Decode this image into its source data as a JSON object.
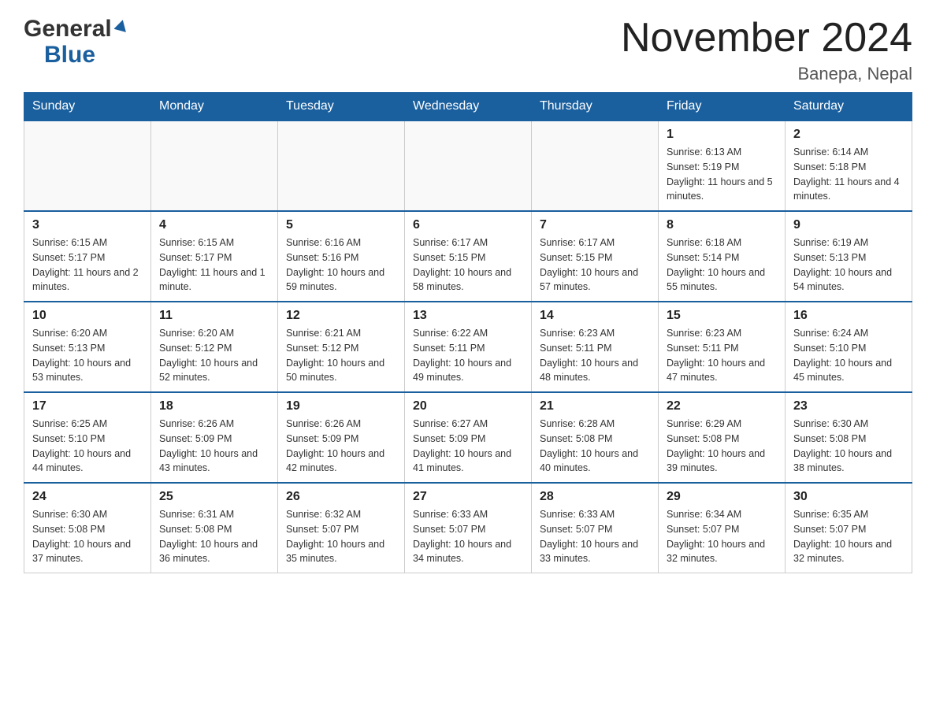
{
  "header": {
    "logo_general": "General",
    "logo_blue": "Blue",
    "title": "November 2024",
    "subtitle": "Banepa, Nepal"
  },
  "days_of_week": [
    "Sunday",
    "Monday",
    "Tuesday",
    "Wednesday",
    "Thursday",
    "Friday",
    "Saturday"
  ],
  "weeks": [
    [
      {
        "day": "",
        "info": ""
      },
      {
        "day": "",
        "info": ""
      },
      {
        "day": "",
        "info": ""
      },
      {
        "day": "",
        "info": ""
      },
      {
        "day": "",
        "info": ""
      },
      {
        "day": "1",
        "info": "Sunrise: 6:13 AM\nSunset: 5:19 PM\nDaylight: 11 hours and 5 minutes."
      },
      {
        "day": "2",
        "info": "Sunrise: 6:14 AM\nSunset: 5:18 PM\nDaylight: 11 hours and 4 minutes."
      }
    ],
    [
      {
        "day": "3",
        "info": "Sunrise: 6:15 AM\nSunset: 5:17 PM\nDaylight: 11 hours and 2 minutes."
      },
      {
        "day": "4",
        "info": "Sunrise: 6:15 AM\nSunset: 5:17 PM\nDaylight: 11 hours and 1 minute."
      },
      {
        "day": "5",
        "info": "Sunrise: 6:16 AM\nSunset: 5:16 PM\nDaylight: 10 hours and 59 minutes."
      },
      {
        "day": "6",
        "info": "Sunrise: 6:17 AM\nSunset: 5:15 PM\nDaylight: 10 hours and 58 minutes."
      },
      {
        "day": "7",
        "info": "Sunrise: 6:17 AM\nSunset: 5:15 PM\nDaylight: 10 hours and 57 minutes."
      },
      {
        "day": "8",
        "info": "Sunrise: 6:18 AM\nSunset: 5:14 PM\nDaylight: 10 hours and 55 minutes."
      },
      {
        "day": "9",
        "info": "Sunrise: 6:19 AM\nSunset: 5:13 PM\nDaylight: 10 hours and 54 minutes."
      }
    ],
    [
      {
        "day": "10",
        "info": "Sunrise: 6:20 AM\nSunset: 5:13 PM\nDaylight: 10 hours and 53 minutes."
      },
      {
        "day": "11",
        "info": "Sunrise: 6:20 AM\nSunset: 5:12 PM\nDaylight: 10 hours and 52 minutes."
      },
      {
        "day": "12",
        "info": "Sunrise: 6:21 AM\nSunset: 5:12 PM\nDaylight: 10 hours and 50 minutes."
      },
      {
        "day": "13",
        "info": "Sunrise: 6:22 AM\nSunset: 5:11 PM\nDaylight: 10 hours and 49 minutes."
      },
      {
        "day": "14",
        "info": "Sunrise: 6:23 AM\nSunset: 5:11 PM\nDaylight: 10 hours and 48 minutes."
      },
      {
        "day": "15",
        "info": "Sunrise: 6:23 AM\nSunset: 5:11 PM\nDaylight: 10 hours and 47 minutes."
      },
      {
        "day": "16",
        "info": "Sunrise: 6:24 AM\nSunset: 5:10 PM\nDaylight: 10 hours and 45 minutes."
      }
    ],
    [
      {
        "day": "17",
        "info": "Sunrise: 6:25 AM\nSunset: 5:10 PM\nDaylight: 10 hours and 44 minutes."
      },
      {
        "day": "18",
        "info": "Sunrise: 6:26 AM\nSunset: 5:09 PM\nDaylight: 10 hours and 43 minutes."
      },
      {
        "day": "19",
        "info": "Sunrise: 6:26 AM\nSunset: 5:09 PM\nDaylight: 10 hours and 42 minutes."
      },
      {
        "day": "20",
        "info": "Sunrise: 6:27 AM\nSunset: 5:09 PM\nDaylight: 10 hours and 41 minutes."
      },
      {
        "day": "21",
        "info": "Sunrise: 6:28 AM\nSunset: 5:08 PM\nDaylight: 10 hours and 40 minutes."
      },
      {
        "day": "22",
        "info": "Sunrise: 6:29 AM\nSunset: 5:08 PM\nDaylight: 10 hours and 39 minutes."
      },
      {
        "day": "23",
        "info": "Sunrise: 6:30 AM\nSunset: 5:08 PM\nDaylight: 10 hours and 38 minutes."
      }
    ],
    [
      {
        "day": "24",
        "info": "Sunrise: 6:30 AM\nSunset: 5:08 PM\nDaylight: 10 hours and 37 minutes."
      },
      {
        "day": "25",
        "info": "Sunrise: 6:31 AM\nSunset: 5:08 PM\nDaylight: 10 hours and 36 minutes."
      },
      {
        "day": "26",
        "info": "Sunrise: 6:32 AM\nSunset: 5:07 PM\nDaylight: 10 hours and 35 minutes."
      },
      {
        "day": "27",
        "info": "Sunrise: 6:33 AM\nSunset: 5:07 PM\nDaylight: 10 hours and 34 minutes."
      },
      {
        "day": "28",
        "info": "Sunrise: 6:33 AM\nSunset: 5:07 PM\nDaylight: 10 hours and 33 minutes."
      },
      {
        "day": "29",
        "info": "Sunrise: 6:34 AM\nSunset: 5:07 PM\nDaylight: 10 hours and 32 minutes."
      },
      {
        "day": "30",
        "info": "Sunrise: 6:35 AM\nSunset: 5:07 PM\nDaylight: 10 hours and 32 minutes."
      }
    ]
  ]
}
